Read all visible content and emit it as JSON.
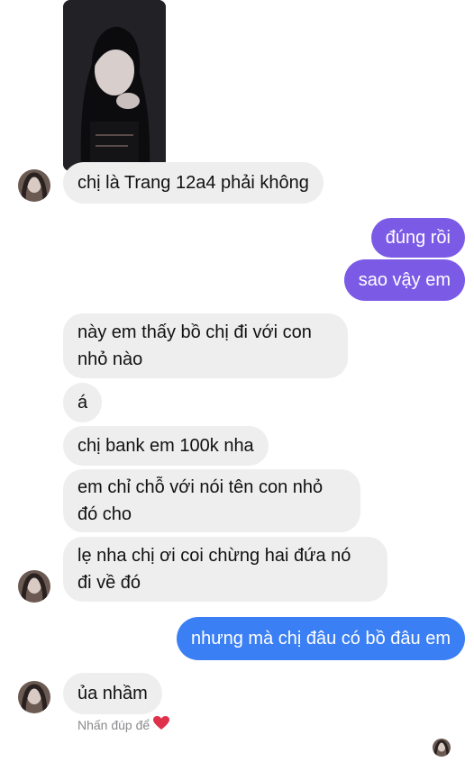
{
  "conversation": {
    "messages": [
      {
        "from": "them",
        "text": "chị là Trang 12a4 phải không"
      },
      {
        "from": "me",
        "text": "đúng rồi"
      },
      {
        "from": "me",
        "text": "sao vậy em"
      },
      {
        "from": "them",
        "line1": "này em thấy bồ chị đi với con",
        "line2": "nhỏ nào"
      },
      {
        "from": "them",
        "text": "á"
      },
      {
        "from": "them",
        "text": "chị bank em 100k nha"
      },
      {
        "from": "them",
        "line1": "em chỉ chỗ với nói tên con nhỏ",
        "line2": "đó cho"
      },
      {
        "from": "them",
        "line1": "lẹ nha chị ơi coi chừng hai đứa nó",
        "line2": "đi về đó"
      },
      {
        "from": "me",
        "text": "nhưng mà chị đâu có bồ đâu em"
      },
      {
        "from": "them",
        "text": "ủa nhầm"
      }
    ],
    "hint_text": "Nhấn đúp để",
    "hint_icon": "heart-icon"
  },
  "colors": {
    "incoming_bubble": "#eeeeef",
    "outgoing_purple": "#7b5be6",
    "outgoing_blue": "#3b7ff4",
    "heart": "#e0314b"
  }
}
